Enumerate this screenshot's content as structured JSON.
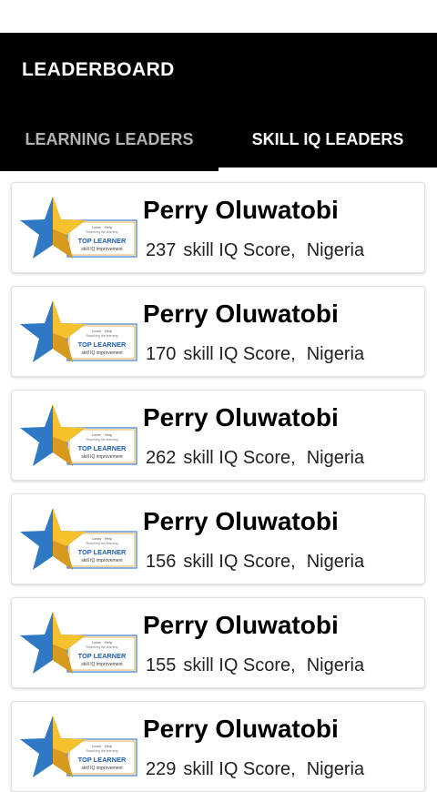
{
  "app_bar": {
    "title": "LEADERBOARD"
  },
  "tabs": [
    {
      "label": "LEARNING LEADERS",
      "active": false
    },
    {
      "label": "SKILL IQ LEADERS",
      "active": true
    }
  ],
  "badge": {
    "icon": "top-learner-badge-icon",
    "line1": "Learn · Help",
    "line2": "Reaching the learning",
    "title": "TOP LEARNER",
    "subtitle": "skill IQ improvement"
  },
  "leaders": [
    {
      "name": "Perry Oluwatobi",
      "score": "237",
      "score_label": "skill IQ Score,",
      "country": "Nigeria"
    },
    {
      "name": "Perry Oluwatobi",
      "score": "170",
      "score_label": "skill IQ Score,",
      "country": "Nigeria"
    },
    {
      "name": "Perry Oluwatobi",
      "score": "262",
      "score_label": "skill IQ Score,",
      "country": "Nigeria"
    },
    {
      "name": "Perry Oluwatobi",
      "score": "156",
      "score_label": "skill IQ Score,",
      "country": "Nigeria"
    },
    {
      "name": "Perry Oluwatobi",
      "score": "155",
      "score_label": "skill IQ Score,",
      "country": "Nigeria"
    },
    {
      "name": "Perry Oluwatobi",
      "score": "229",
      "score_label": "skill IQ Score,",
      "country": "Nigeria"
    }
  ],
  "colors": {
    "app_bar": "#000000",
    "tab_active": "#ffffff",
    "tab_inactive": "#b3b3b3",
    "star_blue": "#2f78c4",
    "star_yellow": "#f6c22b",
    "badge_title": "#1f5fad"
  }
}
